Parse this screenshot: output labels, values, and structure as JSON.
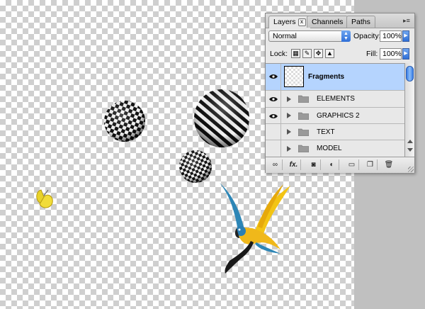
{
  "panel": {
    "tabs": [
      "Layers",
      "Channels",
      "Paths"
    ],
    "tab_close": "x",
    "menu_icon": "▸≡",
    "blend_mode": "Normal",
    "opacity_label": "Opacity:",
    "opacity_value": "100%",
    "lock_label": "Lock:",
    "fill_label": "Fill:",
    "fill_value": "100%",
    "layers": [
      {
        "name": "Fragments",
        "visible": true,
        "selected": true,
        "type": "layer"
      },
      {
        "name": "ELEMENTS",
        "visible": true,
        "selected": false,
        "type": "group"
      },
      {
        "name": "GRAPHICS 2",
        "visible": true,
        "selected": false,
        "type": "group"
      },
      {
        "name": "TEXT",
        "visible": false,
        "selected": false,
        "type": "group"
      },
      {
        "name": "MODEL",
        "visible": false,
        "selected": false,
        "type": "group"
      }
    ],
    "bottom_buttons": [
      "link-layers-icon",
      "fx-icon",
      "layer-mask-icon",
      "adjustment-layer-icon",
      "new-group-icon",
      "new-layer-icon",
      "trash-icon"
    ],
    "fx_label": "fx."
  },
  "colors": {
    "selection": "#b5d4fe",
    "accent_blue": "#2f6fd8",
    "workspace_gray": "#c0c0c0"
  }
}
